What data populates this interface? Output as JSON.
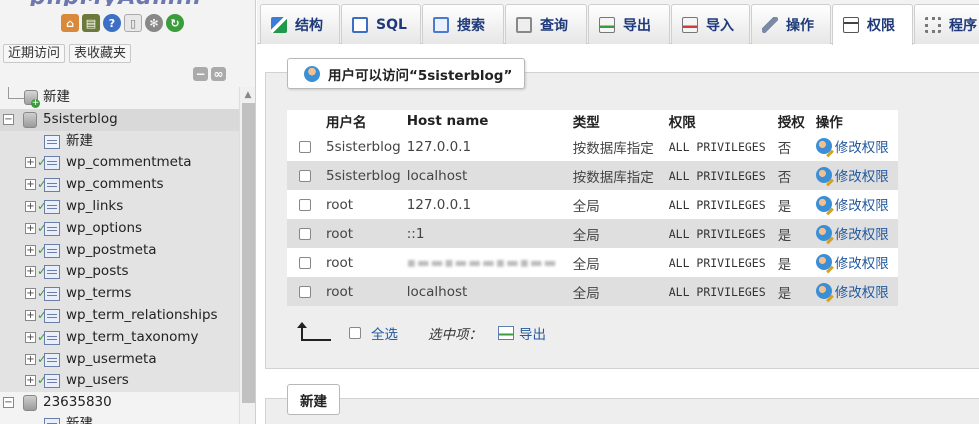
{
  "sidebar": {
    "logo_text": "phpMyAdmin",
    "quick_icons": [
      "home-icon",
      "database-icon",
      "help-icon",
      "docs-icon",
      "settings-icon",
      "reload-icon"
    ],
    "tabs": [
      {
        "label": "近期访问"
      },
      {
        "label": "表收藏夹"
      }
    ],
    "tree": {
      "new_root": "新建",
      "databases": [
        {
          "name": "5sisterblog",
          "new_label": "新建",
          "tables": [
            "wp_commentmeta",
            "wp_comments",
            "wp_links",
            "wp_options",
            "wp_postmeta",
            "wp_posts",
            "wp_terms",
            "wp_term_relationships",
            "wp_term_taxonomy",
            "wp_usermeta",
            "wp_users"
          ]
        },
        {
          "name": "23635830",
          "new_label": "新建"
        }
      ]
    }
  },
  "tabs": [
    {
      "label": "结构",
      "icon": "structure-icon"
    },
    {
      "label": "SQL",
      "icon": "sql-icon"
    },
    {
      "label": "搜索",
      "icon": "search-icon"
    },
    {
      "label": "查询",
      "icon": "query-icon"
    },
    {
      "label": "导出",
      "icon": "export-icon"
    },
    {
      "label": "导入",
      "icon": "import-icon"
    },
    {
      "label": "操作",
      "icon": "wrench-icon"
    },
    {
      "label": "权限",
      "icon": "privileges-icon",
      "active": true
    },
    {
      "label": "程序",
      "icon": "routines-icon"
    }
  ],
  "privileges": {
    "legend": "用户可以访问“5sisterblog”",
    "columns": [
      "用户名",
      "Host name",
      "类型",
      "权限",
      "授权",
      "操作"
    ],
    "rows": [
      {
        "user": "5sisterblog",
        "host": "127.0.0.1",
        "type": "按数据库指定",
        "privileges": "ALL PRIVILEGES",
        "grant": "否",
        "action": "修改权限"
      },
      {
        "user": "5sisterblog",
        "host": "localhost",
        "type": "按数据库指定",
        "privileges": "ALL PRIVILEGES",
        "grant": "否",
        "action": "修改权限"
      },
      {
        "user": "root",
        "host": "127.0.0.1",
        "type": "全局",
        "privileges": "ALL PRIVILEGES",
        "grant": "是",
        "action": "修改权限"
      },
      {
        "user": "root",
        "host": "::1",
        "type": "全局",
        "privileges": "ALL PRIVILEGES",
        "grant": "是",
        "action": "修改权限"
      },
      {
        "user": "root",
        "host": "",
        "type": "全局",
        "privileges": "ALL PRIVILEGES",
        "grant": "是",
        "action": "修改权限"
      },
      {
        "user": "root",
        "host": "localhost",
        "type": "全局",
        "privileges": "ALL PRIVILEGES",
        "grant": "是",
        "action": "修改权限"
      }
    ],
    "bulk": {
      "select_all": "全选",
      "with_selected": "选中项：",
      "export": "导出"
    },
    "new_legend": "新建"
  }
}
